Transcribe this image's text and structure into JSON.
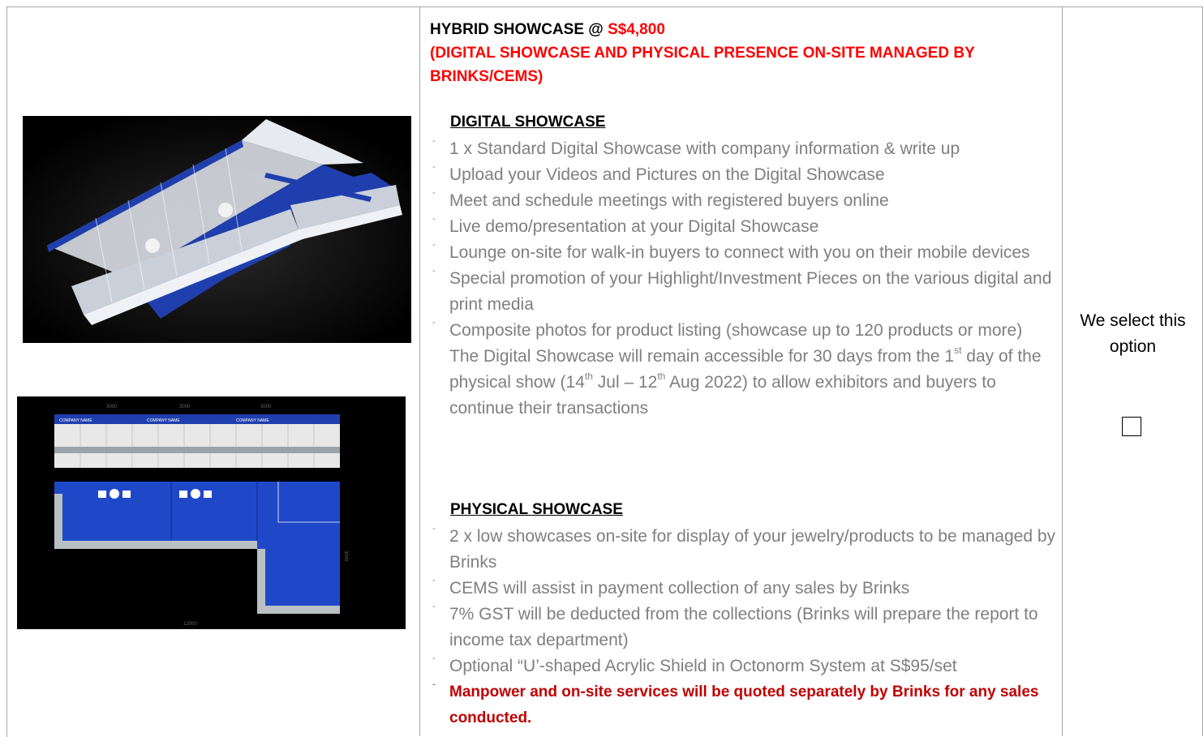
{
  "heading": {
    "title_prefix": "HYBRID SHOWCASE @ ",
    "price": "S$4,800",
    "subtitle": "(DIGITAL SHOWCASE AND PHYSICAL PRESENCE ON-SITE MANAGED BY BRINKS/CEMS)"
  },
  "digital": {
    "title": "DIGITAL SHOWCASE",
    "items": [
      "1 x Standard Digital Showcase with company information & write up",
      "Upload your Videos and Pictures on the Digital Showcase",
      "Meet and schedule meetings with registered buyers online",
      "Live demo/presentation at your Digital Showcase",
      "Lounge on-site for walk-in buyers to connect with you on their mobile devices",
      "Special promotion of your Highlight/Investment Pieces on the various digital and print media",
      "Composite photos for product listing (showcase up to 120 products or more)"
    ],
    "note_parts": {
      "a": "The Digital Showcase will remain accessible for 30 days from the 1",
      "a_sup": "st",
      "b": " day of the physical show (14",
      "b_sup": "th",
      "c": " Jul – 12",
      "c_sup": "th",
      "d": " Aug 2022) to allow exhibitors and buyers to continue their transactions"
    }
  },
  "physical": {
    "title": "PHYSICAL SHOWCASE",
    "items": [
      "2 x low showcases on-site for display of your jewelry/products to be managed by Brinks",
      "CEMS will assist in payment collection of any sales by Brinks",
      "7% GST will be deducted from the collections (Brinks will prepare the report to income tax department)",
      "Optional “U’-shaped Acrylic Shield in Octonorm System at S$95/set"
    ],
    "emphasis": "Manpower and on-site services will be quoted separately by Brinks for any sales conducted."
  },
  "select": {
    "label": "We select this option",
    "checked": false
  },
  "plan_labels": {
    "top_dims": [
      "3000",
      "3000",
      "3000"
    ],
    "banners": [
      "COMPANY NAME",
      "COMPANY NAME",
      "COMPANY NAME"
    ],
    "bottom_dim": "12000",
    "side_dim": "3000"
  },
  "colors": {
    "accent_red": "#ff0000",
    "emphasis_red": "#c00000",
    "body_gray": "#7f7f7f",
    "booth_blue": "#1f3fae"
  }
}
